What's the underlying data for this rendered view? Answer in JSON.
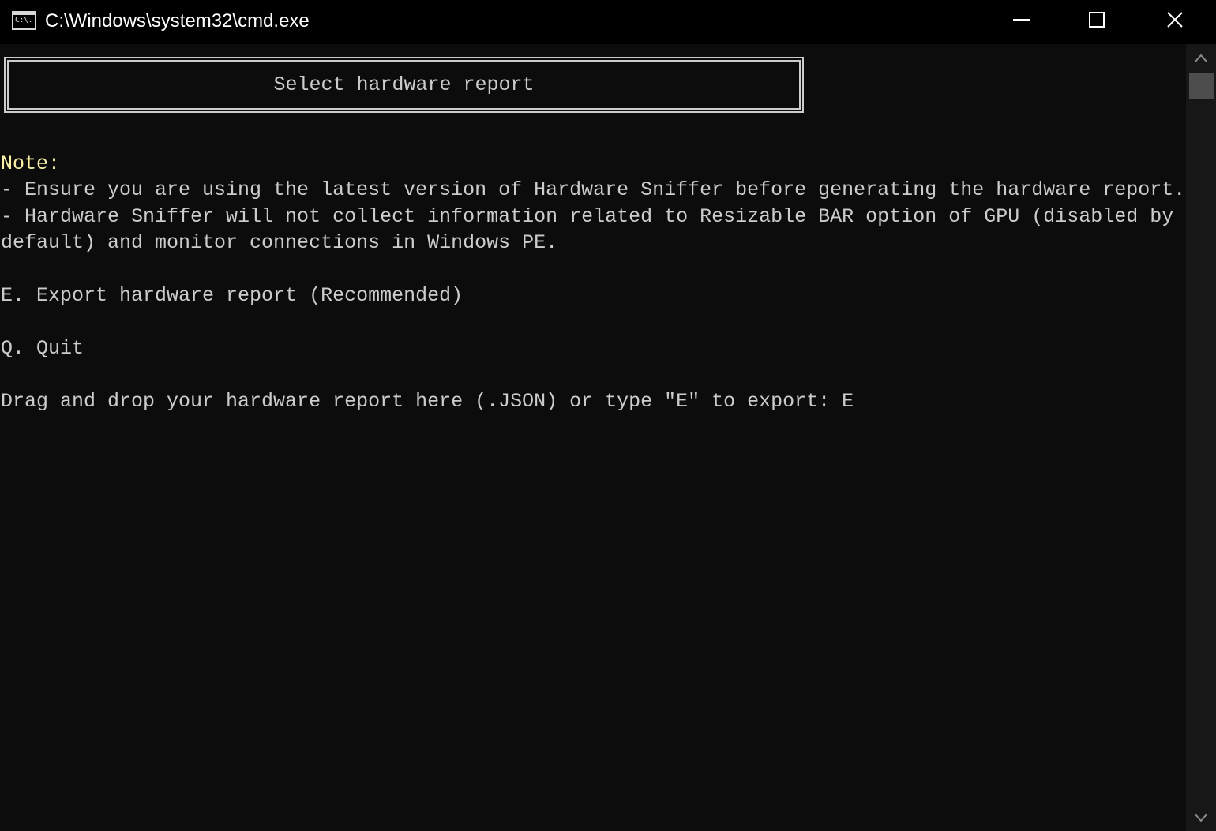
{
  "window": {
    "title": "C:\\Windows\\system32\\cmd.exe",
    "icon": "cmd-icon",
    "icon_text": "C:\\."
  },
  "controls": {
    "minimize": "minimize-icon",
    "maximize": "maximize-icon",
    "close": "close-icon"
  },
  "console": {
    "header": "Select hardware report",
    "note_label": "Note:",
    "note_line_1": "- Ensure you are using the latest version of Hardware Sniffer before generating the hardware report.",
    "note_line_2": "- Hardware Sniffer will not collect information related to Resizable BAR option of GPU (disabled by",
    "note_line_3": "default) and monitor connections in Windows PE.",
    "option_export": "E. Export hardware report (Recommended)",
    "option_quit": "Q. Quit",
    "prompt": "Drag and drop your hardware report here (.JSON) or type \"E\" to export: E"
  },
  "colors": {
    "background": "#0c0c0c",
    "text": "#cccccc",
    "note": "#f9f1a5",
    "titlebar": "#000000"
  }
}
